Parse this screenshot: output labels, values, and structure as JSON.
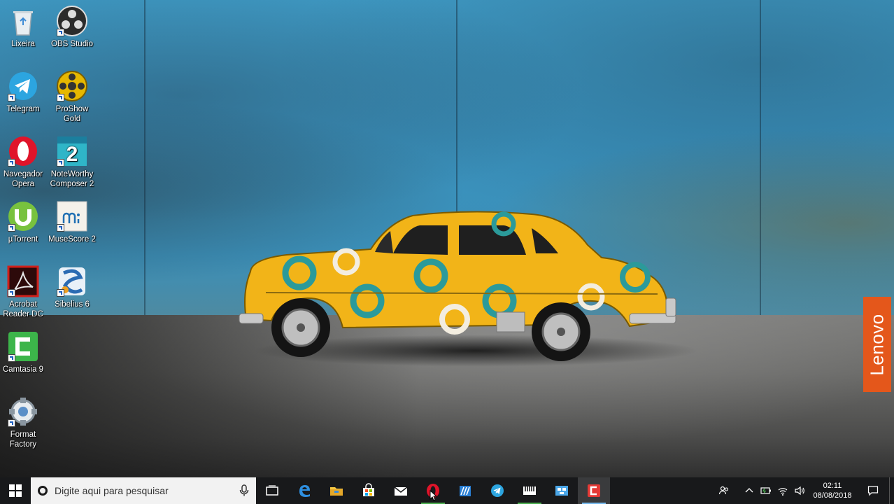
{
  "desktop": {
    "icons": [
      {
        "label": "Lixeira",
        "icon": "recycle-bin-icon"
      },
      {
        "label": "OBS Studio",
        "icon": "obs-icon"
      },
      {
        "label": "Telegram",
        "icon": "telegram-icon"
      },
      {
        "label": "ProShow Gold",
        "icon": "proshow-icon"
      },
      {
        "label": "Navegador Opera",
        "icon": "opera-icon"
      },
      {
        "label": "NoteWorthy Composer 2",
        "icon": "noteworthy-icon"
      },
      {
        "label": "µTorrent",
        "icon": "utorrent-icon"
      },
      {
        "label": "MuseScore 2",
        "icon": "musescore-icon"
      },
      {
        "label": "Acrobat Reader DC",
        "icon": "acrobat-icon"
      },
      {
        "label": "Sibelius 6",
        "icon": "sibelius-icon"
      },
      {
        "label": "Camtasia 9",
        "icon": "camtasia-icon"
      },
      {
        "label": "Format Factory",
        "icon": "format-factory-icon"
      }
    ],
    "wallpaper_brand": "Lenovo"
  },
  "taskbar": {
    "search_placeholder": "Digite aqui para pesquisar",
    "apps": [
      "task-view-icon",
      "edge-icon",
      "file-explorer-icon",
      "store-icon",
      "mail-icon",
      "opera-icon",
      "kdenlive-icon",
      "telegram-icon",
      "piano-icon",
      "network-app-icon",
      "camtasia-icon"
    ],
    "clock": {
      "time": "02:11",
      "date": "08/08/2018"
    }
  },
  "colors": {
    "taskbar_bg": "#18191b",
    "active_indicator": "#76b9ed",
    "lenovo_orange": "#e4571b",
    "car_yellow": "#f2b418",
    "car_pattern": "#2b9a9a"
  }
}
